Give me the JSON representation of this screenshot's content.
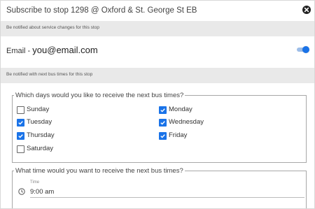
{
  "dialog": {
    "title": "Subscribe to stop 1298 @ Oxford & St. George St EB",
    "close_icon": "close-circle-icon"
  },
  "service_section": {
    "header": "Be notified about service changes for this stop",
    "email_prefix": "Email - ",
    "email": "you@email.com",
    "toggle_on": true
  },
  "next_bus_section": {
    "header": "Be notified with next bus times for this stop"
  },
  "days": {
    "legend": "Which days would you like to receive the next bus times?",
    "items": [
      {
        "label": "Sunday",
        "checked": false
      },
      {
        "label": "Tuesday",
        "checked": true
      },
      {
        "label": "Thursday",
        "checked": true
      },
      {
        "label": "Saturday",
        "checked": false
      },
      {
        "label": "Monday",
        "checked": true
      },
      {
        "label": "Wednesday",
        "checked": true
      },
      {
        "label": "Friday",
        "checked": true
      }
    ]
  },
  "time": {
    "legend": "What time would you want to receive the next bus times?",
    "caption": "Time",
    "value": "9:00 am",
    "icon": "clock-icon"
  },
  "colors": {
    "accent": "#1a73e8",
    "section_bg": "#e9e9e9"
  }
}
